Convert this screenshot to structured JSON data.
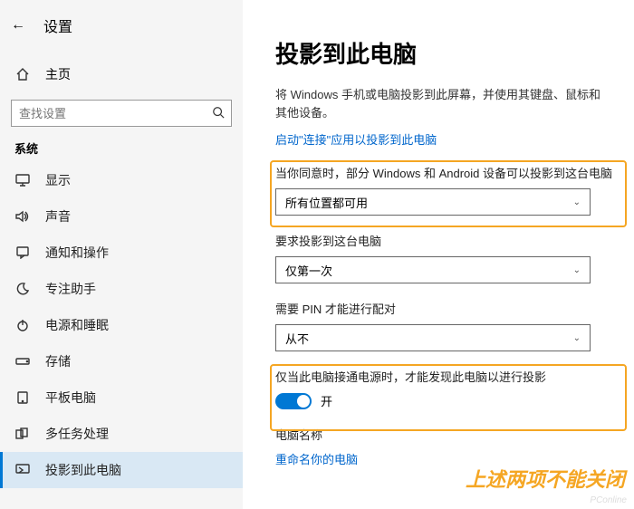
{
  "header": {
    "back": "←",
    "title": "设置"
  },
  "home": {
    "label": "主页"
  },
  "search": {
    "placeholder": "查找设置"
  },
  "section": "系统",
  "nav": [
    {
      "label": "显示",
      "id": "display"
    },
    {
      "label": "声音",
      "id": "sound"
    },
    {
      "label": "通知和操作",
      "id": "notifications"
    },
    {
      "label": "专注助手",
      "id": "focus"
    },
    {
      "label": "电源和睡眠",
      "id": "power"
    },
    {
      "label": "存储",
      "id": "storage"
    },
    {
      "label": "平板电脑",
      "id": "tablet"
    },
    {
      "label": "多任务处理",
      "id": "multitask"
    },
    {
      "label": "投影到此电脑",
      "id": "project"
    }
  ],
  "main": {
    "title": "投影到此电脑",
    "desc": "将 Windows 手机或电脑投影到此屏幕，并使用其键盘、鼠标和其他设备。",
    "link": "启动\"连接\"应用以投影到此电脑",
    "g1": {
      "label": "当你同意时，部分 Windows 和 Android 设备可以投影到这台电脑",
      "value": "所有位置都可用"
    },
    "g2": {
      "label": "要求投影到这台电脑",
      "value": "仅第一次"
    },
    "g3": {
      "label": "需要 PIN 才能进行配对",
      "value": "从不"
    },
    "g4": {
      "label": "仅当此电脑接通电源时，才能发现此电脑以进行投影",
      "value": "开"
    },
    "pcname_label": "电脑名称",
    "rename": "重命名你的电脑"
  },
  "annotation": "上述两项不能关闭",
  "watermark": "PConline"
}
